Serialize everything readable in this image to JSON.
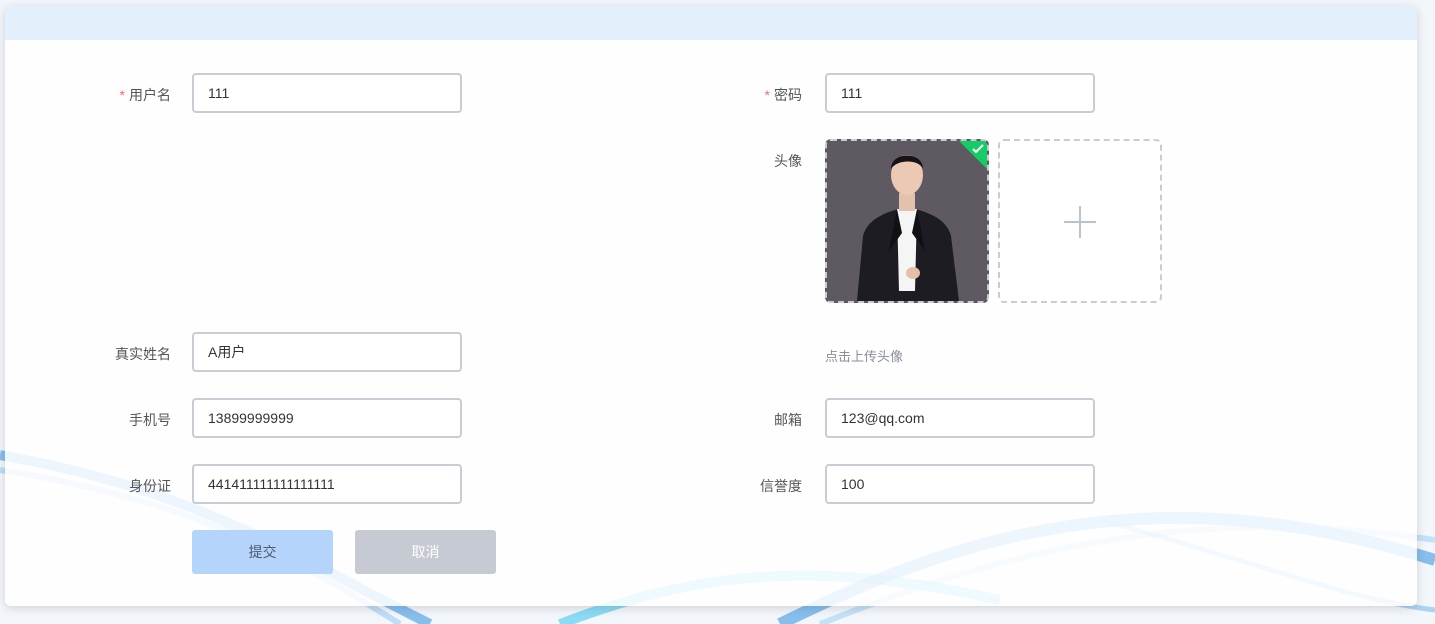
{
  "form": {
    "username": {
      "label": "用户名",
      "required": true,
      "value": "111"
    },
    "password": {
      "label": "密码",
      "required": true,
      "value": "111"
    },
    "avatar": {
      "label": "头像",
      "hint": "点击上传头像",
      "uploaded": true
    },
    "realname": {
      "label": "真实姓名",
      "value": "A用户"
    },
    "phone": {
      "label": "手机号",
      "value": "13899999999"
    },
    "email": {
      "label": "邮箱",
      "value": "123@qq.com"
    },
    "idcard": {
      "label": "身份证",
      "value": "441411111111111111"
    },
    "credit": {
      "label": "信誉度",
      "value": "100"
    }
  },
  "buttons": {
    "submit": "提交",
    "cancel": "取消"
  },
  "icons": {
    "required_mark": "*",
    "upload_plus": "plus-icon",
    "upload_success": "check-icon"
  },
  "colors": {
    "required": "#f56c6c",
    "success_corner": "#13ce66",
    "submit_bg": "#b5d4fb",
    "cancel_bg": "#c6cad3",
    "header_band": "#e3effb"
  }
}
